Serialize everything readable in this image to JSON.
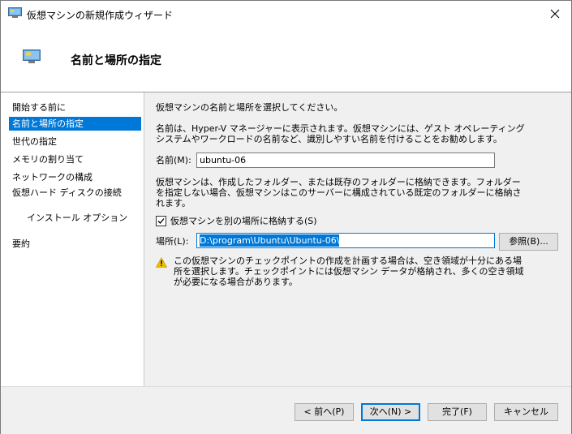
{
  "window": {
    "title": "仮想マシンの新規作成ウィザード"
  },
  "header": {
    "title": "名前と場所の指定"
  },
  "sidebar": {
    "items": [
      {
        "label": "開始する前に"
      },
      {
        "label": "名前と場所の指定"
      },
      {
        "label": "世代の指定"
      },
      {
        "label": "メモリの割り当て"
      },
      {
        "label": "ネットワークの構成"
      },
      {
        "label": "仮想ハード ディスクの接続"
      },
      {
        "label": "インストール オプション"
      },
      {
        "label": "要約"
      }
    ]
  },
  "main": {
    "intro": "仮想マシンの名前と場所を選択してください。",
    "name_desc": "名前は、Hyper-V マネージャーに表示されます。仮想マシンには、ゲスト オペレーティング\nシステムやワークロードの名前など、識別しやすい名前を付けることをお勧めします。",
    "name_label": "名前(M):",
    "name_value": "ubuntu-06",
    "folder_desc": "仮想マシンは、作成したフォルダー、または既存のフォルダーに格納できます。フォルダー\nを指定しない場合、仮想マシンはこのサーバーに構成されている既定のフォルダーに格納さ\nれます。",
    "store_checkbox_label": "仮想マシンを別の場所に格納する(S)",
    "store_checked": true,
    "location_label": "場所(L):",
    "location_value": "D:\\program\\Ubuntu\\Ubuntu-06\\",
    "browse_label": "参照(B)...",
    "warning_text": "この仮想マシンのチェックポイントの作成を計画する場合は、空き領域が十分にある場\n所を選択します。チェックポイントには仮想マシン データが格納され、多くの空き領域\nが必要になる場合があります。"
  },
  "footer": {
    "prev_label": "< 前へ(P)",
    "next_label": "次へ(N) >",
    "finish_label": "完了(F)",
    "cancel_label": "キャンセル"
  },
  "colors": {
    "accent": "#0078d7",
    "warning": "#f2c200"
  }
}
